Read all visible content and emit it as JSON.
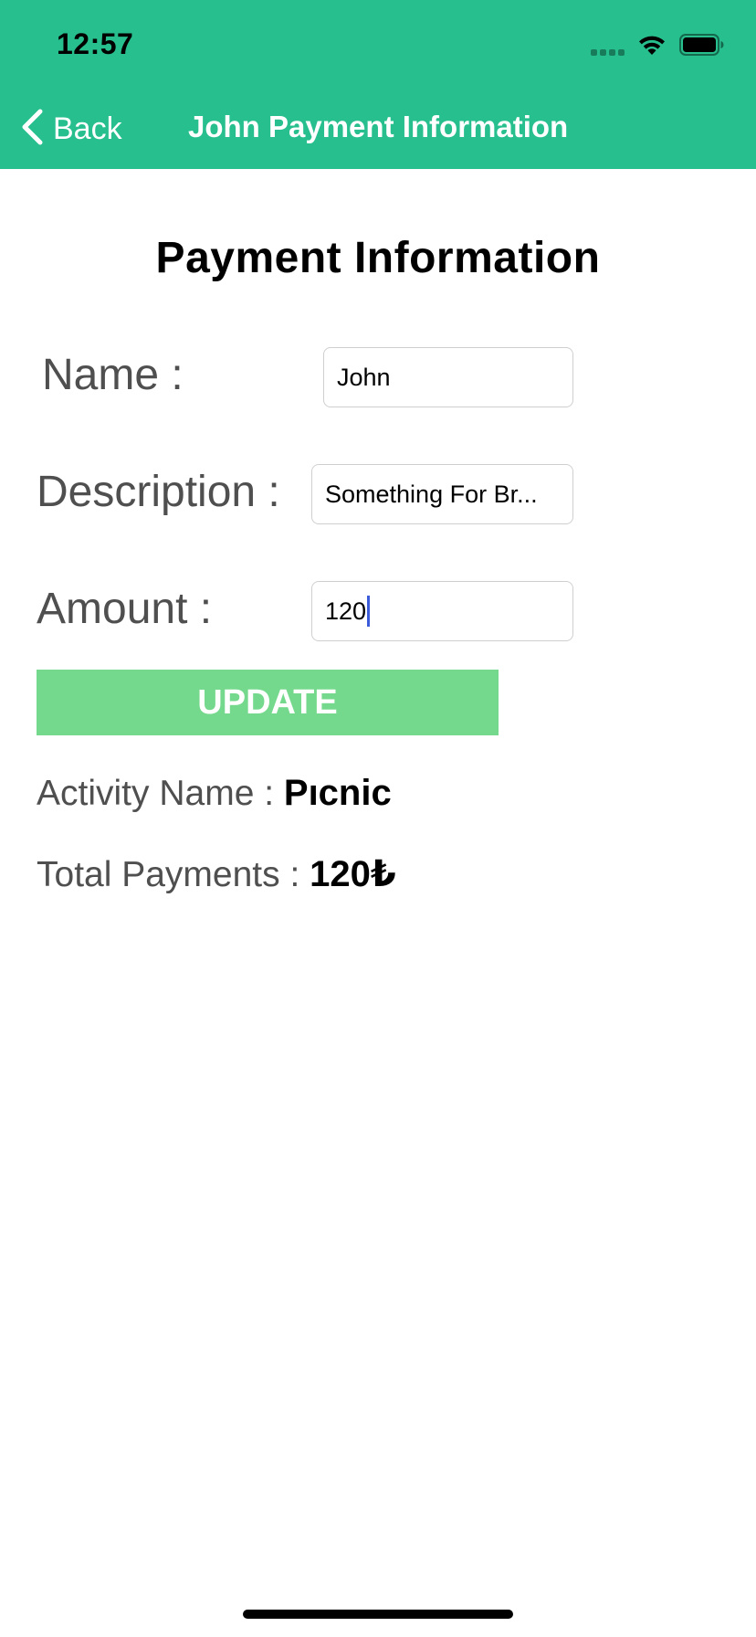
{
  "status_bar": {
    "time": "12:57",
    "icons": [
      "signal-icon",
      "wifi-icon",
      "battery-icon"
    ]
  },
  "nav": {
    "back_label": "Back",
    "title": "John Payment Information",
    "background_color": "#26bf8d"
  },
  "page": {
    "title": "Payment Information"
  },
  "form": {
    "name_label": "Name :",
    "name_value": "John",
    "description_label": "Description :",
    "description_value": "Something For Br...",
    "amount_label": "Amount :",
    "amount_value": "120",
    "update_label": "UPDATE",
    "update_color": "#74d98c"
  },
  "summary": {
    "activity_label": "Activity Name : ",
    "activity_value": "Pıcnic",
    "total_label": "Total Payments : ",
    "total_value": "120₺"
  }
}
